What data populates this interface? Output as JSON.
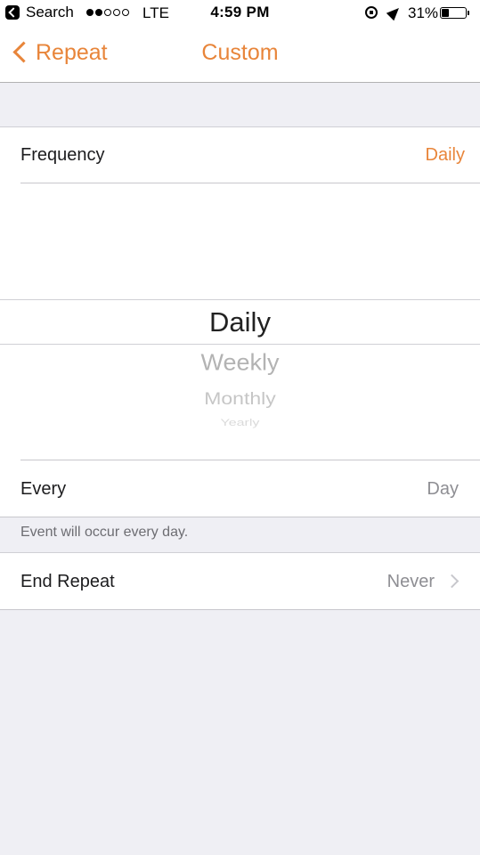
{
  "status_bar": {
    "back_app": "Search",
    "carrier": "LTE",
    "time": "4:59 PM",
    "battery_percent": "31%",
    "battery_level": 0.31,
    "signal_bars_filled": 2,
    "signal_bars_total": 5
  },
  "nav": {
    "back_label": "Repeat",
    "title": "Custom"
  },
  "frequency": {
    "label": "Frequency",
    "value": "Daily"
  },
  "picker": {
    "selected": "Daily",
    "options": [
      "Daily",
      "Weekly",
      "Monthly",
      "Yearly"
    ]
  },
  "every": {
    "label": "Every",
    "value": "Day"
  },
  "footer_note": "Event will occur every day.",
  "end_repeat": {
    "label": "End Repeat",
    "value": "Never"
  },
  "colors": {
    "accent": "#e8853a",
    "background": "#efeff4",
    "secondary_text": "#8e8e93"
  }
}
